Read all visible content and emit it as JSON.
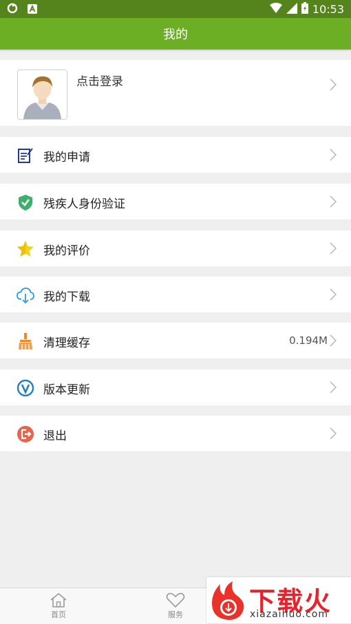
{
  "status_bar": {
    "time": "10:53"
  },
  "header": {
    "title": "我的"
  },
  "profile": {
    "login_label": "点击登录"
  },
  "menu": [
    {
      "icon": "document-edit-icon",
      "label": "我的申请",
      "value": ""
    },
    {
      "icon": "shield-check-icon",
      "label": "残疾人身份验证",
      "value": ""
    },
    {
      "icon": "star-icon",
      "label": "我的评价",
      "value": ""
    },
    {
      "icon": "cloud-download-icon",
      "label": "我的下载",
      "value": ""
    },
    {
      "icon": "broom-icon",
      "label": "清理缓存",
      "value": "0.194M"
    },
    {
      "icon": "version-v-icon",
      "label": "版本更新",
      "value": ""
    },
    {
      "icon": "logout-icon",
      "label": "退出",
      "value": ""
    }
  ],
  "tab_bar": [
    {
      "icon": "home-icon",
      "label": "首页"
    },
    {
      "icon": "heart-icon",
      "label": "服务"
    }
  ],
  "watermark": {
    "title": "下载火",
    "subtitle": "xiazaihuo.com"
  },
  "colors": {
    "primary": "#6daf24",
    "status_bar": "#55831c",
    "background": "#efefef"
  }
}
